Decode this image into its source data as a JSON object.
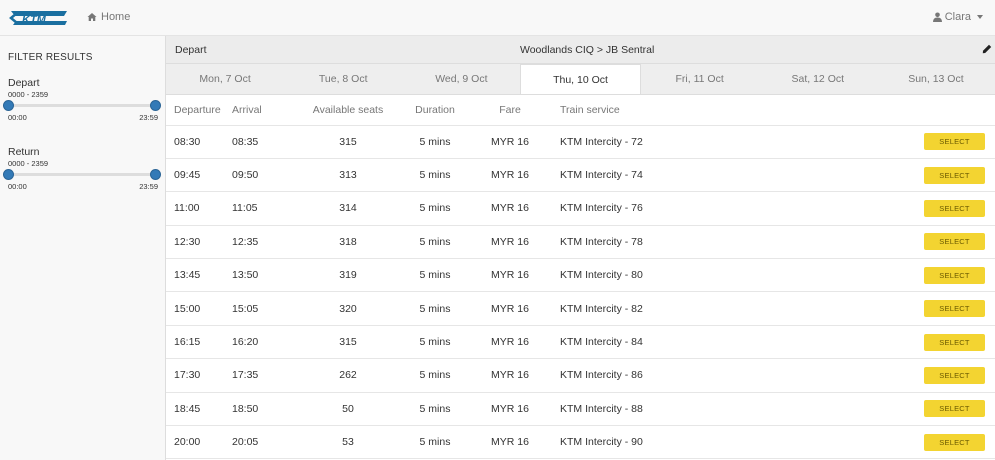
{
  "navbar": {
    "logo_text": "KTM",
    "home_label": "Home",
    "user_label": "Clara"
  },
  "sidebar": {
    "title": "FILTER RESULTS",
    "depart": {
      "label": "Depart",
      "range": "0000 - 2359",
      "min_label": "00:00",
      "max_label": "23:59",
      "low": 0.0,
      "high": 1.0
    },
    "return": {
      "label": "Return",
      "range": "0000 - 2359",
      "min_label": "00:00",
      "max_label": "23:59",
      "low": 0.0,
      "high": 1.0
    }
  },
  "route": {
    "depart_label": "Depart",
    "name": "Woodlands CIQ > JB Sentral"
  },
  "date_tabs": [
    {
      "label": "Mon, 7 Oct",
      "active": false
    },
    {
      "label": "Tue, 8 Oct",
      "active": false
    },
    {
      "label": "Wed, 9 Oct",
      "active": false
    },
    {
      "label": "Thu, 10 Oct",
      "active": true
    },
    {
      "label": "Fri, 11 Oct",
      "active": false
    },
    {
      "label": "Sat, 12 Oct",
      "active": false
    },
    {
      "label": "Sun, 13 Oct",
      "active": false
    }
  ],
  "table": {
    "headers": {
      "departure": "Departure",
      "arrival": "Arrival",
      "seats": "Available seats",
      "duration": "Duration",
      "fare": "Fare",
      "service": "Train service"
    },
    "select_label": "SELECT",
    "rows": [
      {
        "departure": "08:30",
        "arrival": "08:35",
        "seats": "315",
        "duration": "5 mins",
        "fare": "MYR 16",
        "service": "KTM Intercity - 72"
      },
      {
        "departure": "09:45",
        "arrival": "09:50",
        "seats": "313",
        "duration": "5 mins",
        "fare": "MYR 16",
        "service": "KTM Intercity - 74"
      },
      {
        "departure": "11:00",
        "arrival": "11:05",
        "seats": "314",
        "duration": "5 mins",
        "fare": "MYR 16",
        "service": "KTM Intercity - 76"
      },
      {
        "departure": "12:30",
        "arrival": "12:35",
        "seats": "318",
        "duration": "5 mins",
        "fare": "MYR 16",
        "service": "KTM Intercity - 78"
      },
      {
        "departure": "13:45",
        "arrival": "13:50",
        "seats": "319",
        "duration": "5 mins",
        "fare": "MYR 16",
        "service": "KTM Intercity - 80"
      },
      {
        "departure": "15:00",
        "arrival": "15:05",
        "seats": "320",
        "duration": "5 mins",
        "fare": "MYR 16",
        "service": "KTM Intercity - 82"
      },
      {
        "departure": "16:15",
        "arrival": "16:20",
        "seats": "315",
        "duration": "5 mins",
        "fare": "MYR 16",
        "service": "KTM Intercity - 84"
      },
      {
        "departure": "17:30",
        "arrival": "17:35",
        "seats": "262",
        "duration": "5 mins",
        "fare": "MYR 16",
        "service": "KTM Intercity - 86"
      },
      {
        "departure": "18:45",
        "arrival": "18:50",
        "seats": "50",
        "duration": "5 mins",
        "fare": "MYR 16",
        "service": "KTM Intercity - 88"
      },
      {
        "departure": "20:00",
        "arrival": "20:05",
        "seats": "53",
        "duration": "5 mins",
        "fare": "MYR 16",
        "service": "KTM Intercity - 90"
      }
    ]
  },
  "colors": {
    "select_button": "#f3d431",
    "slider_handle": "#337ab7",
    "logo": "#1a6fa0"
  }
}
